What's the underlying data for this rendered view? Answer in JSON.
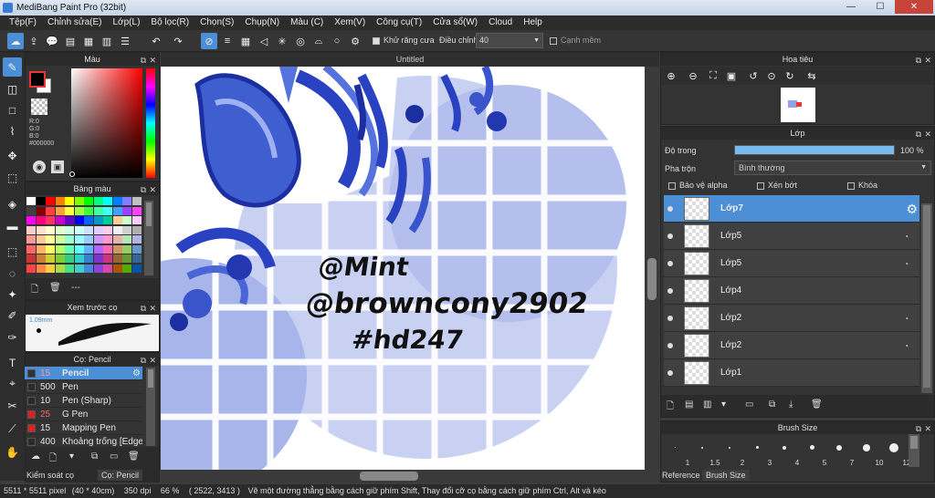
{
  "window": {
    "title": "MediBang Paint Pro (32bit)"
  },
  "menu": [
    "Tệp(F)",
    "Chỉnh sửa(E)",
    "Lớp(L)",
    "Bộ lọc(R)",
    "Chọn(S)",
    "Chụp(N)",
    "Màu (C)",
    "Xem(V)",
    "Công cụ(T)",
    "Cửa sổ(W)",
    "Cloud",
    "Help"
  ],
  "toolbar": {
    "antialias_label": "Khử răng cưa",
    "adjust_label": "Điều chỉnh",
    "adjust_value": "40",
    "sharp_label": "Cạnh mềm"
  },
  "color_panel": {
    "title": "Màu",
    "r": "R:0",
    "g": "G:0",
    "b": "B:0",
    "hex": "#000000"
  },
  "palette_panel": {
    "title": "Bảng màu",
    "dash": "---"
  },
  "brush_preview": {
    "title": "Xem trước cọ",
    "size": "1.09mm"
  },
  "brush_panel": {
    "title": "Cọ: Pencil",
    "items": [
      {
        "size": "15",
        "name": "Pencil",
        "color": "#333333"
      },
      {
        "size": "500",
        "name": "Pen",
        "color": "#2b2b2b"
      },
      {
        "size": "10",
        "name": "Pen (Sharp)",
        "color": "#2b2b2b"
      },
      {
        "size": "25",
        "name": "G Pen",
        "color": "#e02020"
      },
      {
        "size": "15",
        "name": "Mapping Pen",
        "color": "#e02020"
      },
      {
        "size": "400",
        "name": "Khoảng trống [Edge I",
        "color": "#2b2b2b"
      }
    ]
  },
  "left_tabs": [
    "Kiểm soát cọ",
    "Cọ: Pencil"
  ],
  "canvas": {
    "tab_title": "Untitled",
    "text_line1": "@Mint",
    "text_line2": "@browncony2902",
    "text_line3": "#hd247"
  },
  "navigator": {
    "title": "Hoa tiêu"
  },
  "layers_panel": {
    "title": "Lớp",
    "opacity_label": "Độ trong",
    "opacity_value": "100 %",
    "opacity_fraction": 1.0,
    "blend_label": "Pha trộn",
    "blend_value": "Bình thường",
    "protect_alpha": "Bảo vệ alpha",
    "clipping": "Xén bớt",
    "lock": "Khóa",
    "layers": [
      {
        "name": "Lớp7",
        "selected": true
      },
      {
        "name": "Lớp5"
      },
      {
        "name": "Lớp5"
      },
      {
        "name": "Lớp4"
      },
      {
        "name": "Lớp2"
      },
      {
        "name": "Lớp2"
      },
      {
        "name": "Lớp1"
      }
    ]
  },
  "brush_size_panel": {
    "title": "Brush Size",
    "sizes": [
      "1",
      "1.5",
      "2",
      "3",
      "4",
      "5",
      "7",
      "10",
      "12"
    ],
    "tabs": [
      "Reference",
      "Brush Size"
    ]
  },
  "status": {
    "dims": "5511 * 5511 pixel",
    "cm": "(40 * 40cm)",
    "dpi": "350 dpi",
    "zoom": "66 %",
    "coords": "( 2522, 3413 )",
    "hint": "Vẽ một đường thẳng bằng cách giữ phím Shift, Thay đổi cỡ cọ bằng cách giữ phím Ctrl, Alt và kéo"
  }
}
